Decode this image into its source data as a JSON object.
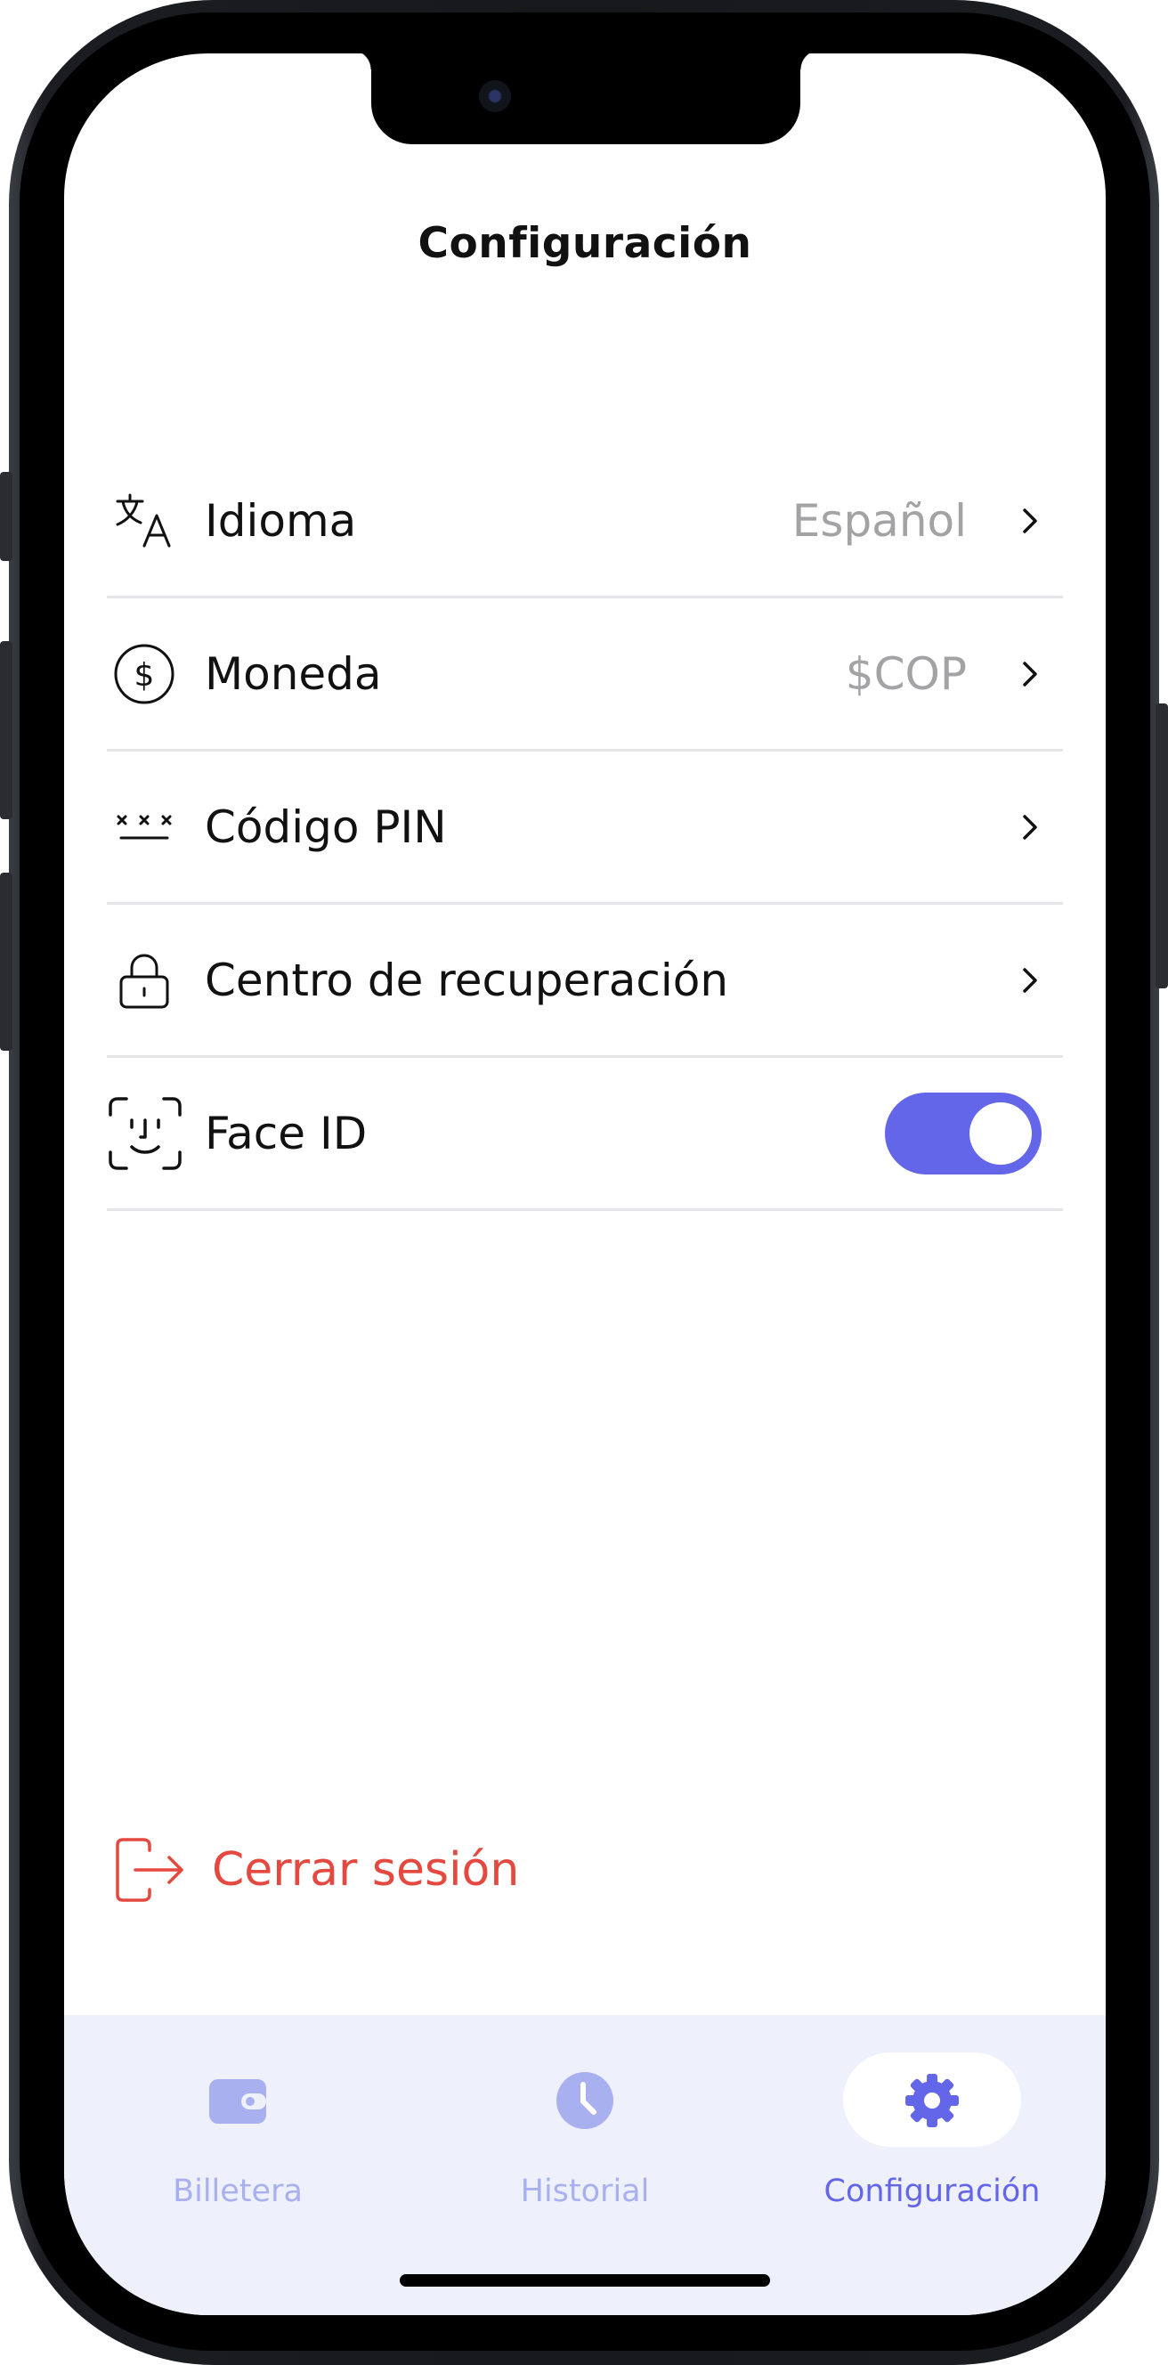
{
  "header": {
    "title": "Configuración"
  },
  "settings": {
    "items": [
      {
        "label": "Idioma",
        "value": "Español",
        "icon": "translate-icon"
      },
      {
        "label": "Moneda",
        "value": "$COP",
        "icon": "dollar-circle-icon"
      },
      {
        "label": "Código PIN",
        "value": "",
        "icon": "pin-code-icon"
      },
      {
        "label": "Centro de recuperación",
        "value": "",
        "icon": "lock-icon"
      },
      {
        "label": "Face ID",
        "toggle_on": true,
        "icon": "face-id-icon"
      }
    ]
  },
  "logout": {
    "label": "Cerrar sesión",
    "icon": "logout-icon"
  },
  "tabbar": {
    "tabs": [
      {
        "label": "Billetera",
        "icon": "wallet-icon",
        "active": false
      },
      {
        "label": "Historial",
        "icon": "clock-icon",
        "active": false
      },
      {
        "label": "Configuración",
        "icon": "gear-icon",
        "active": true
      }
    ]
  },
  "colors": {
    "accent": "#6366e8",
    "inactive_tab": "#a9b0f0",
    "danger": "#e5483e",
    "muted_text": "#a3a3a6",
    "tabbar_bg": "#eef0fc"
  }
}
